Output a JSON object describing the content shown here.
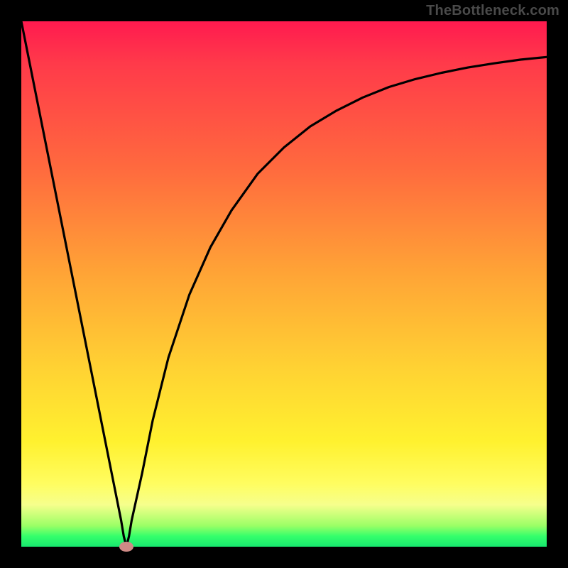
{
  "site_label": "TheBottleneck.com",
  "colors": {
    "frame": "#000000",
    "label": "#4a4a4a",
    "curve": "#000000",
    "marker": "#cf8a86",
    "gradient_top": "#ff1a4f",
    "gradient_bottom": "#17e86e"
  },
  "chart_data": {
    "type": "line",
    "title": "",
    "xlabel": "",
    "ylabel": "",
    "xlim": [
      0,
      100
    ],
    "ylim": [
      0,
      100
    ],
    "x": [
      0,
      2,
      4,
      6,
      8,
      10,
      12,
      14,
      16,
      18,
      19,
      19.5,
      20,
      20.5,
      21,
      23,
      25,
      28,
      32,
      36,
      40,
      45,
      50,
      55,
      60,
      65,
      70,
      75,
      80,
      85,
      90,
      95,
      100
    ],
    "y": [
      100,
      90,
      80,
      70,
      60,
      50,
      40,
      30,
      20,
      10,
      5,
      2,
      0,
      2,
      5,
      14,
      24,
      36,
      48,
      57,
      64,
      71,
      76,
      80,
      83,
      85.5,
      87.5,
      89,
      90.2,
      91.2,
      92,
      92.7,
      93.2
    ],
    "marker": {
      "x": 20,
      "y": 0
    },
    "grid": false,
    "legend": false
  }
}
